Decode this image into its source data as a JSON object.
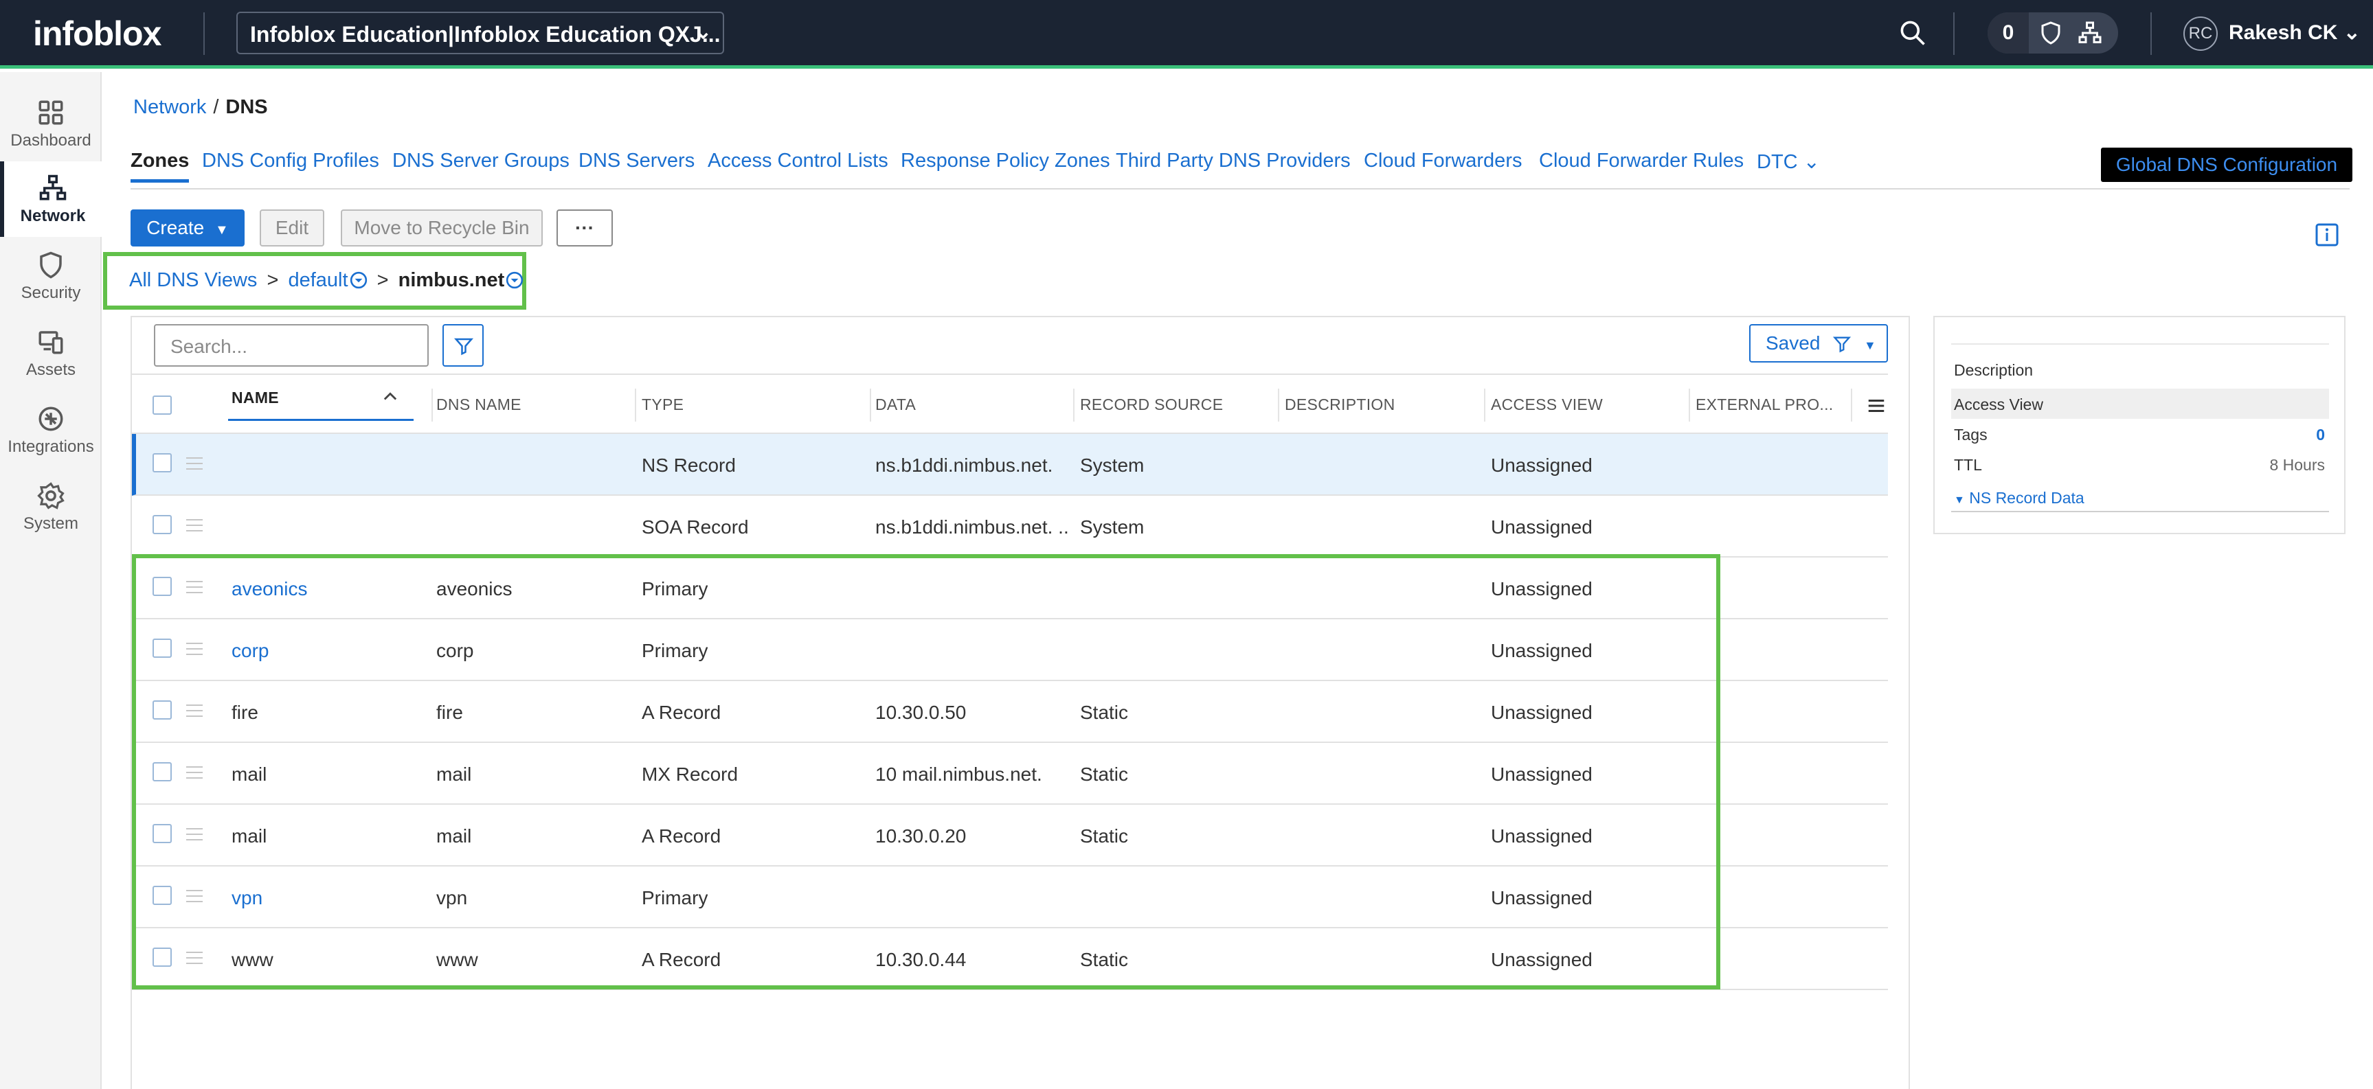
{
  "topbar": {
    "logo": "infoblox",
    "account": "Infoblox Education|Infoblox Education QXJ...",
    "notification_count": "0",
    "avatar_initials": "RC",
    "user_name": "Rakesh CK"
  },
  "leftnav": [
    {
      "label": "Dashboard",
      "icon": "dashboard-icon"
    },
    {
      "label": "Network",
      "icon": "network-icon"
    },
    {
      "label": "Security",
      "icon": "shield-icon"
    },
    {
      "label": "Assets",
      "icon": "assets-icon"
    },
    {
      "label": "Integrations",
      "icon": "integrations-icon"
    },
    {
      "label": "System",
      "icon": "gear-icon"
    }
  ],
  "breadcrumb": {
    "parent": "Network",
    "separator": "/",
    "current": "DNS"
  },
  "tabs": [
    "Zones",
    "DNS Config Profiles",
    "DNS Server Groups",
    "DNS Servers",
    "Access Control Lists",
    "Response Policy Zones",
    "Third Party DNS Providers",
    "Cloud Forwarders",
    "Cloud Forwarder Rules",
    "DTC"
  ],
  "global_button": "Global DNS Configuration",
  "toolbar": {
    "create": "Create",
    "edit": "Edit",
    "recycle": "Move to Recycle Bin",
    "more": "···"
  },
  "dns_path": {
    "root": "All DNS Views",
    "sep": ">",
    "view": "default",
    "zone": "nimbus.net"
  },
  "table": {
    "search_placeholder": "Search...",
    "saved_label": "Saved",
    "columns": [
      "NAME",
      "DNS NAME",
      "TYPE",
      "DATA",
      "RECORD SOURCE",
      "DESCRIPTION",
      "ACCESS VIEW",
      "EXTERNAL PRO..."
    ],
    "rows": [
      {
        "name": "",
        "dns_name": "",
        "type": "NS Record",
        "data": "ns.b1ddi.nimbus.net.",
        "source": "System",
        "description": "",
        "access_view": "Unassigned",
        "link": false
      },
      {
        "name": "",
        "dns_name": "",
        "type": "SOA Record",
        "data": "ns.b1ddi.nimbus.net. ...",
        "source": "System",
        "description": "",
        "access_view": "Unassigned",
        "link": false
      },
      {
        "name": "aveonics",
        "dns_name": "aveonics",
        "type": "Primary",
        "data": "",
        "source": "",
        "description": "",
        "access_view": "Unassigned",
        "link": true
      },
      {
        "name": "corp",
        "dns_name": "corp",
        "type": "Primary",
        "data": "",
        "source": "",
        "description": "",
        "access_view": "Unassigned",
        "link": true
      },
      {
        "name": "fire",
        "dns_name": "fire",
        "type": "A Record",
        "data": "10.30.0.50",
        "source": "Static",
        "description": "",
        "access_view": "Unassigned",
        "link": false
      },
      {
        "name": "mail",
        "dns_name": "mail",
        "type": "MX Record",
        "data": "10 mail.nimbus.net.",
        "source": "Static",
        "description": "",
        "access_view": "Unassigned",
        "link": false
      },
      {
        "name": "mail",
        "dns_name": "mail",
        "type": "A Record",
        "data": "10.30.0.20",
        "source": "Static",
        "description": "",
        "access_view": "Unassigned",
        "link": false
      },
      {
        "name": "vpn",
        "dns_name": "vpn",
        "type": "Primary",
        "data": "",
        "source": "",
        "description": "",
        "access_view": "Unassigned",
        "link": true
      },
      {
        "name": "www",
        "dns_name": "www",
        "type": "A Record",
        "data": "10.30.0.44",
        "source": "Static",
        "description": "",
        "access_view": "Unassigned",
        "link": false
      }
    ]
  },
  "detail": {
    "description_label": "Description",
    "access_view_label": "Access View",
    "tags_label": "Tags",
    "tags_value": "0",
    "ttl_label": "TTL",
    "ttl_value": "8 Hours",
    "section_label": "NS Record Data"
  },
  "colors": {
    "accent": "#1a6fd0",
    "highlight": "#62c04a",
    "topbar": "#1b2433"
  }
}
